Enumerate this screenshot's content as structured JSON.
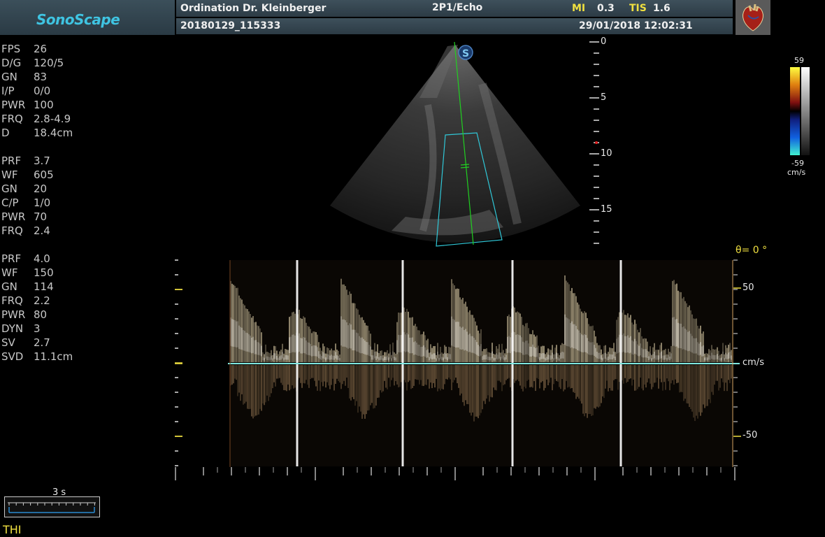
{
  "header": {
    "brand": "SonoScape",
    "clinic": "Ordination Dr. Kleinberger",
    "probe_preset": "2P1/Echo",
    "mi_label": "MI",
    "mi_value": "0.3",
    "tis_label": "TIS",
    "tis_value": "1.6",
    "patient_id": "20180129_115333",
    "datetime": "29/01/2018 12:02:31"
  },
  "params_bmode": [
    {
      "key": "FPS",
      "value": "26"
    },
    {
      "key": "D/G",
      "value": "120/5"
    },
    {
      "key": "GN",
      "value": "83"
    },
    {
      "key": "I/P",
      "value": "0/0"
    },
    {
      "key": "PWR",
      "value": "100"
    },
    {
      "key": "FRQ",
      "value": "2.8-4.9"
    },
    {
      "key": "D",
      "value": "18.4cm"
    }
  ],
  "params_color": [
    {
      "key": "PRF",
      "value": "3.7"
    },
    {
      "key": "WF",
      "value": "605"
    },
    {
      "key": "GN",
      "value": "20"
    },
    {
      "key": "C/P",
      "value": "1/0"
    },
    {
      "key": "PWR",
      "value": "70"
    },
    {
      "key": "FRQ",
      "value": "2.4"
    }
  ],
  "params_pw": [
    {
      "key": "PRF",
      "value": "4.0"
    },
    {
      "key": "WF",
      "value": "150"
    },
    {
      "key": "GN",
      "value": "114"
    },
    {
      "key": "FRQ",
      "value": "2.2"
    },
    {
      "key": "PWR",
      "value": "80"
    },
    {
      "key": "DYN",
      "value": "3"
    },
    {
      "key": "SV",
      "value": "2.7"
    },
    {
      "key": "SVD",
      "value": "11.1cm"
    }
  ],
  "depth_scale": {
    "labels": [
      "0",
      "5",
      "10",
      "15"
    ]
  },
  "colorbar": {
    "max": "59",
    "min": "-59",
    "unit": "cm/s"
  },
  "doppler": {
    "angle_label": "θ= 0 °",
    "scale_labels": {
      "pos": "50",
      "baseline": "cm/s",
      "neg": "-50"
    }
  },
  "time_scale": {
    "label": "3 s"
  },
  "mode_label": "THI",
  "colors": {
    "accent_yellow": "#f0e040",
    "baseline_cyan": "#7fe8e0",
    "doppler_tint": "#e8d8b0",
    "sample_gate_green": "#20d020"
  }
}
